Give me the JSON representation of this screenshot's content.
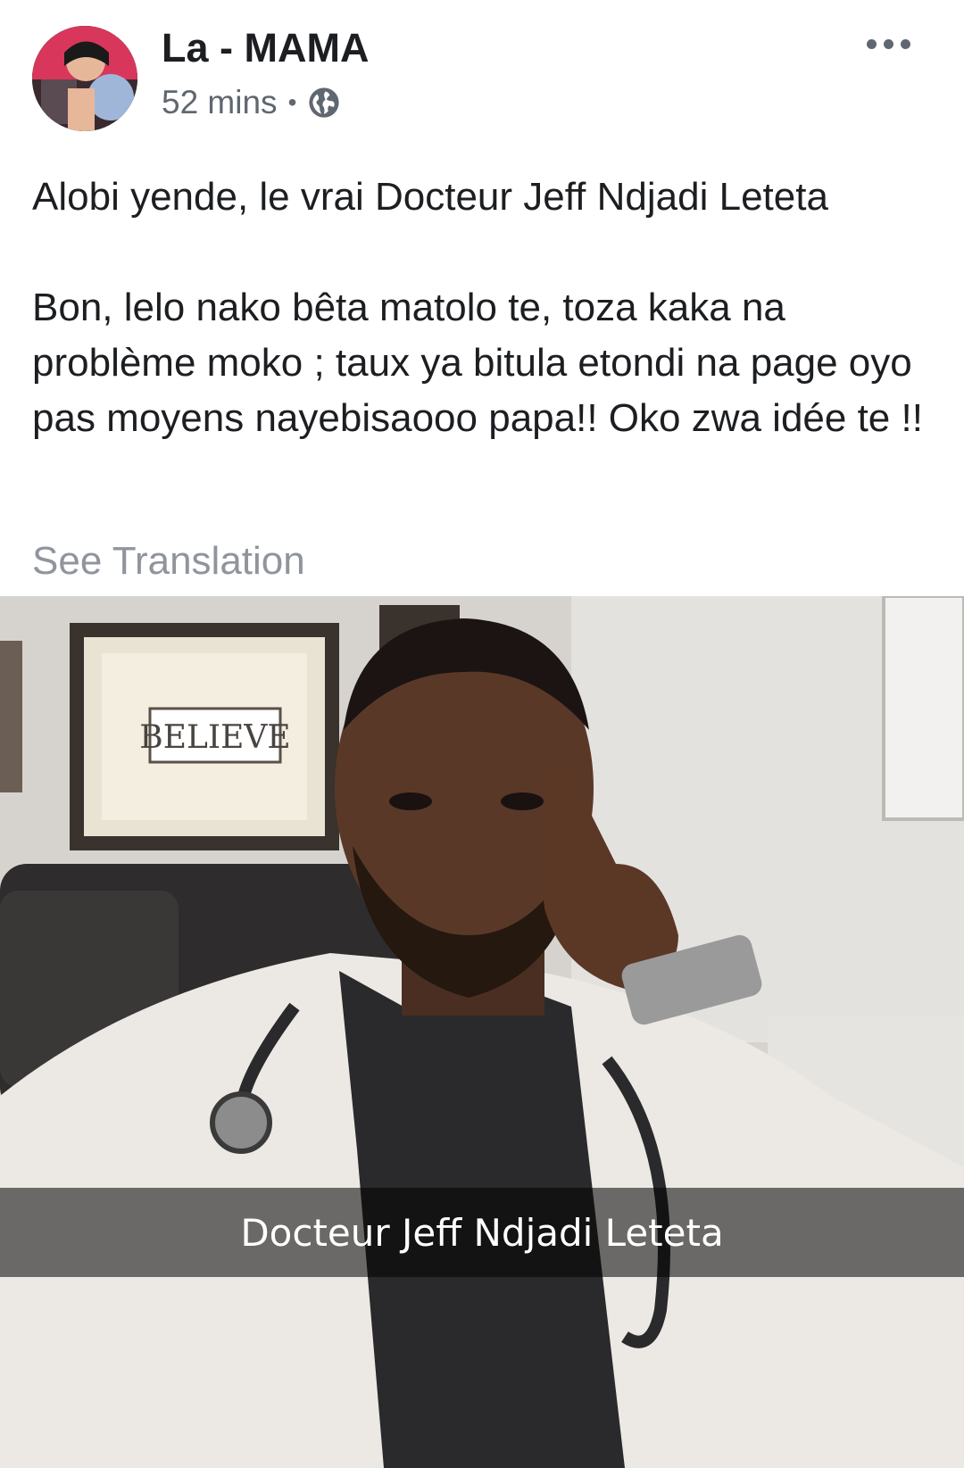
{
  "post": {
    "author": "La - MAMA",
    "time": "52 mins",
    "separator": "•",
    "audience_icon": "globe-icon",
    "more_icon": "more-options-icon",
    "paragraphs": [
      "Alobi yende, le vrai Docteur Jeff Ndjadi Leteta",
      "Bon, lelo nako bêta matolo te, toza kaka na problème moko ; taux ya bitula etondi na page oyo pas moyens nayebisaooo papa!! Oko zwa idée te !!"
    ],
    "see_translation": "See Translation"
  },
  "photo": {
    "sign_text": "BELIEVE",
    "caption": "Docteur Jeff Ndjadi Leteta"
  },
  "colors": {
    "text": "#1c1e21",
    "meta": "#606770",
    "translation": "#90949c"
  }
}
